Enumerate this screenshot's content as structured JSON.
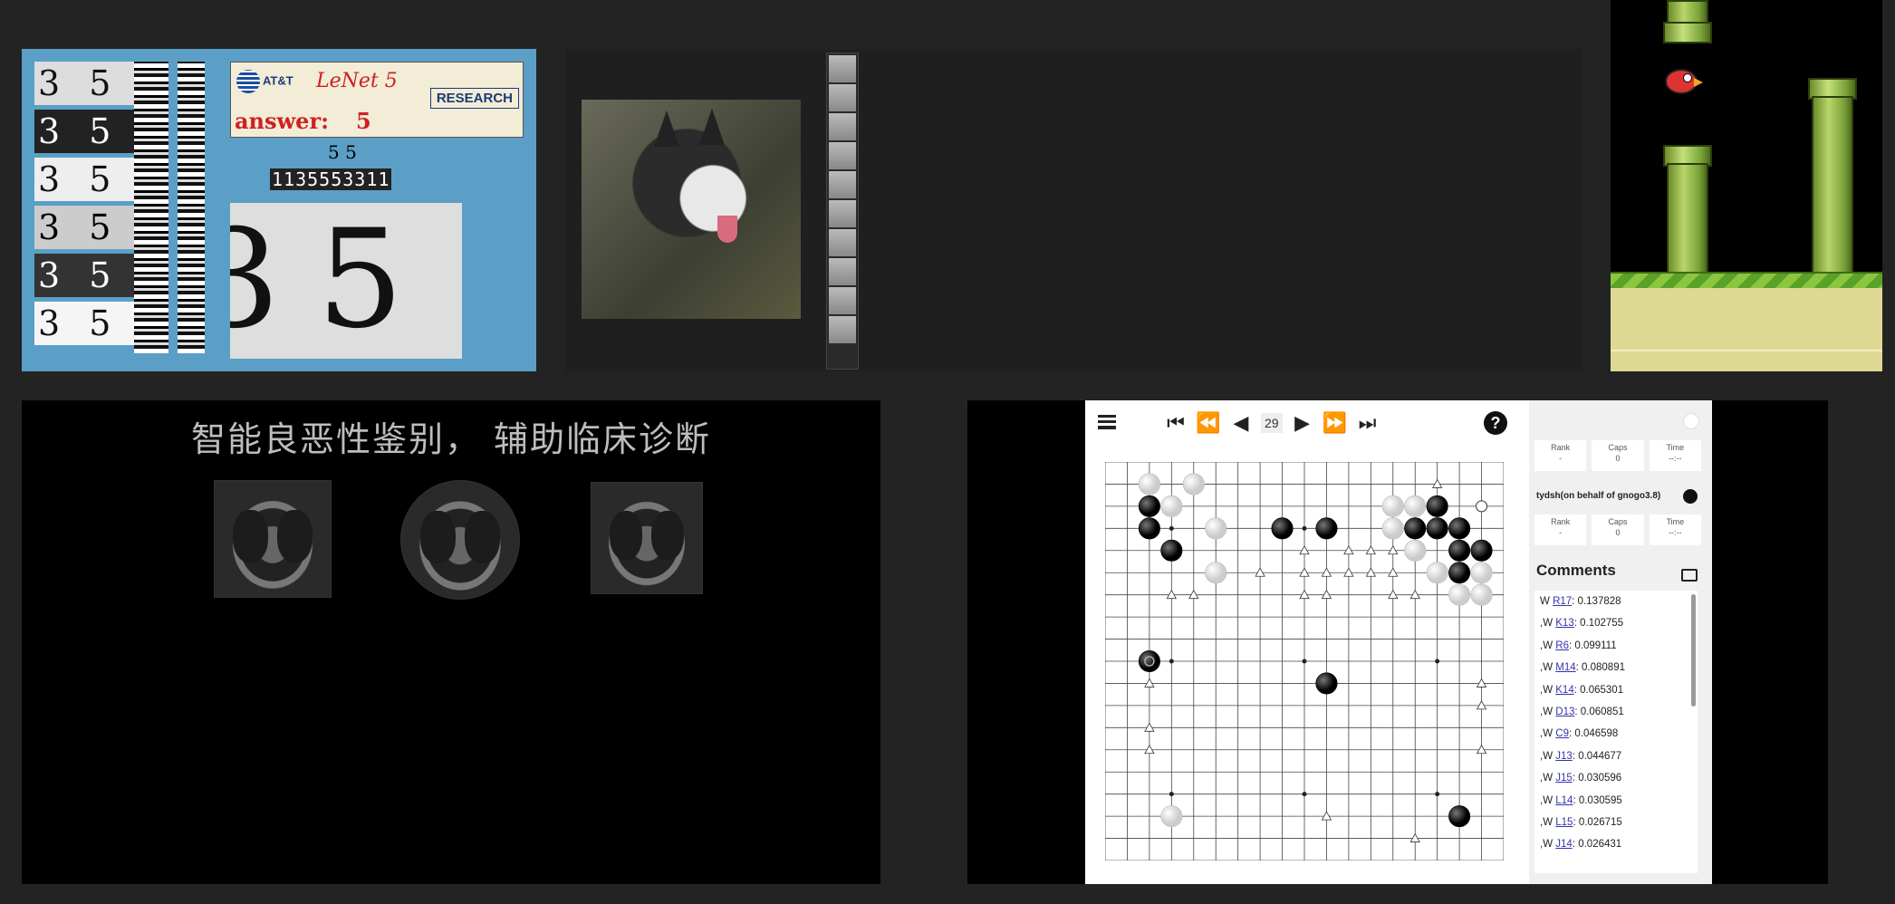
{
  "lenet": {
    "logo_text": "AT&T",
    "title": "LeNet 5",
    "research": "RESEARCH",
    "answer_label": "answer:",
    "answer_value": "5",
    "prediction": "5 5",
    "sequence": "1135553311",
    "digit_tiles": [
      "3 5",
      "3 5",
      "3 5",
      "3 5",
      "3 5",
      "3 5"
    ],
    "big_digits": [
      "3",
      "5"
    ]
  },
  "medical": {
    "title": "智能良恶性鉴别，  辅助临床诊断"
  },
  "go": {
    "move_number": "29",
    "opponent_labels": {
      "rank": "Rank",
      "caps": "Caps",
      "time": "Time",
      "rank_val": "-",
      "caps_val": "0",
      "time_val": "--:--"
    },
    "player_name": "tydsh(on behalf of gnogo3.8)",
    "player_labels": {
      "rank": "Rank",
      "caps": "Caps",
      "time": "Time",
      "rank_val": "-",
      "caps_val": "0",
      "time_val": "--:--"
    },
    "comments_title": "Comments",
    "comments": [
      {
        "prefix": "W",
        "move": "R17",
        "value": ": 0.137828"
      },
      {
        "prefix": ",W",
        "move": "K13",
        "value": ": 0.102755"
      },
      {
        "prefix": ",W",
        "move": "R6",
        "value": ": 0.099111"
      },
      {
        "prefix": ",W",
        "move": "M14",
        "value": ": 0.080891"
      },
      {
        "prefix": ",W",
        "move": "K14",
        "value": ": 0.065301"
      },
      {
        "prefix": ",W",
        "move": "D13",
        "value": ": 0.060851"
      },
      {
        "prefix": ",W",
        "move": "C9",
        "value": ": 0.046598"
      },
      {
        "prefix": ",W",
        "move": "J13",
        "value": ": 0.044677"
      },
      {
        "prefix": ",W",
        "move": "J15",
        "value": ": 0.030596"
      },
      {
        "prefix": ",W",
        "move": "L14",
        "value": ": 0.030595"
      },
      {
        "prefix": ",W",
        "move": "L15",
        "value": ": 0.026715"
      },
      {
        "prefix": ",W",
        "move": "J14",
        "value": ": 0.026431"
      }
    ],
    "stones": [
      {
        "c": "w",
        "x": 2,
        "y": 1
      },
      {
        "c": "w",
        "x": 4,
        "y": 1
      },
      {
        "c": "b",
        "x": 2,
        "y": 2
      },
      {
        "c": "w",
        "x": 3,
        "y": 2
      },
      {
        "c": "b",
        "x": 2,
        "y": 3
      },
      {
        "c": "w",
        "x": 5,
        "y": 3
      },
      {
        "c": "b",
        "x": 8,
        "y": 3
      },
      {
        "c": "b",
        "x": 10,
        "y": 3
      },
      {
        "c": "b",
        "x": 3,
        "y": 4
      },
      {
        "c": "w",
        "x": 5,
        "y": 5
      },
      {
        "c": "w",
        "x": 13,
        "y": 2
      },
      {
        "c": "w",
        "x": 14,
        "y": 2
      },
      {
        "c": "b",
        "x": 15,
        "y": 2
      },
      {
        "c": "w",
        "x": 13,
        "y": 3
      },
      {
        "c": "b",
        "x": 14,
        "y": 3
      },
      {
        "c": "b",
        "x": 15,
        "y": 3
      },
      {
        "c": "b",
        "x": 16,
        "y": 3
      },
      {
        "c": "w",
        "x": 14,
        "y": 4
      },
      {
        "c": "b",
        "x": 16,
        "y": 4
      },
      {
        "c": "b",
        "x": 17,
        "y": 4
      },
      {
        "c": "w",
        "x": 15,
        "y": 5
      },
      {
        "c": "b",
        "x": 16,
        "y": 5
      },
      {
        "c": "w",
        "x": 17,
        "y": 5
      },
      {
        "c": "w",
        "x": 16,
        "y": 6
      },
      {
        "c": "w",
        "x": 17,
        "y": 6
      },
      {
        "c": "b",
        "x": 2,
        "y": 9,
        "last": true
      },
      {
        "c": "b",
        "x": 10,
        "y": 10
      },
      {
        "c": "w",
        "x": 3,
        "y": 16
      },
      {
        "c": "b",
        "x": 16,
        "y": 16
      }
    ],
    "marks": [
      [
        15,
        1
      ],
      [
        9,
        4
      ],
      [
        11,
        4
      ],
      [
        12,
        4
      ],
      [
        13,
        4
      ],
      [
        7,
        5
      ],
      [
        9,
        5
      ],
      [
        10,
        5
      ],
      [
        11,
        5
      ],
      [
        12,
        5
      ],
      [
        13,
        5
      ],
      [
        3,
        6
      ],
      [
        4,
        6
      ],
      [
        9,
        6
      ],
      [
        10,
        6
      ],
      [
        13,
        6
      ],
      [
        14,
        6
      ],
      [
        2,
        10
      ],
      [
        17,
        10
      ],
      [
        17,
        11
      ],
      [
        2,
        12
      ],
      [
        2,
        13
      ],
      [
        17,
        13
      ],
      [
        10,
        16
      ],
      [
        14,
        17
      ]
    ],
    "circle_marks": [
      [
        17,
        2
      ]
    ]
  }
}
